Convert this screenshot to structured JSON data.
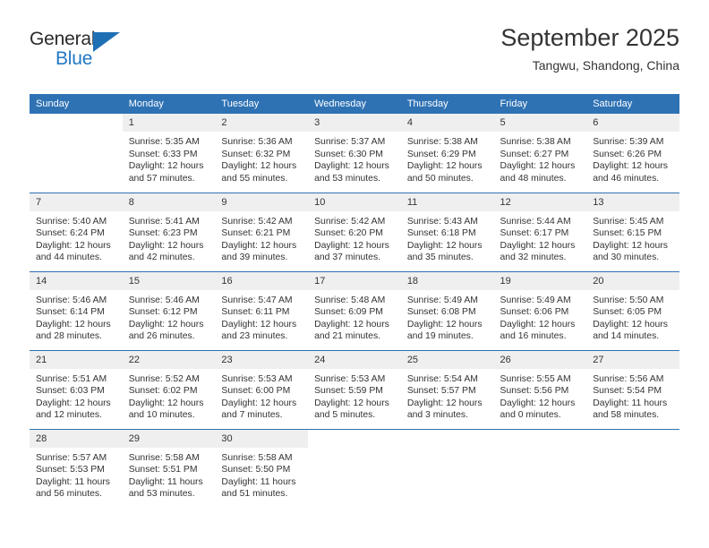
{
  "brand": {
    "name_part1": "General",
    "name_part2": "Blue",
    "triangle_icon": "triangle-icon"
  },
  "header": {
    "title": "September 2025",
    "subtitle": "Tangwu, Shandong, China"
  },
  "colors": {
    "header_blue": "#2e72b4",
    "daynum_band": "#efefef",
    "text": "#333333",
    "brand_blue": "#2278c4"
  },
  "calendar": {
    "weekday_headers": [
      "Sunday",
      "Monday",
      "Tuesday",
      "Wednesday",
      "Thursday",
      "Friday",
      "Saturday"
    ],
    "weeks": [
      [
        {
          "day": "",
          "sunrise": "",
          "sunset": "",
          "daylight_line1": "",
          "daylight_line2": ""
        },
        {
          "day": "1",
          "sunrise": "Sunrise: 5:35 AM",
          "sunset": "Sunset: 6:33 PM",
          "daylight_line1": "Daylight: 12 hours",
          "daylight_line2": "and 57 minutes."
        },
        {
          "day": "2",
          "sunrise": "Sunrise: 5:36 AM",
          "sunset": "Sunset: 6:32 PM",
          "daylight_line1": "Daylight: 12 hours",
          "daylight_line2": "and 55 minutes."
        },
        {
          "day": "3",
          "sunrise": "Sunrise: 5:37 AM",
          "sunset": "Sunset: 6:30 PM",
          "daylight_line1": "Daylight: 12 hours",
          "daylight_line2": "and 53 minutes."
        },
        {
          "day": "4",
          "sunrise": "Sunrise: 5:38 AM",
          "sunset": "Sunset: 6:29 PM",
          "daylight_line1": "Daylight: 12 hours",
          "daylight_line2": "and 50 minutes."
        },
        {
          "day": "5",
          "sunrise": "Sunrise: 5:38 AM",
          "sunset": "Sunset: 6:27 PM",
          "daylight_line1": "Daylight: 12 hours",
          "daylight_line2": "and 48 minutes."
        },
        {
          "day": "6",
          "sunrise": "Sunrise: 5:39 AM",
          "sunset": "Sunset: 6:26 PM",
          "daylight_line1": "Daylight: 12 hours",
          "daylight_line2": "and 46 minutes."
        }
      ],
      [
        {
          "day": "7",
          "sunrise": "Sunrise: 5:40 AM",
          "sunset": "Sunset: 6:24 PM",
          "daylight_line1": "Daylight: 12 hours",
          "daylight_line2": "and 44 minutes."
        },
        {
          "day": "8",
          "sunrise": "Sunrise: 5:41 AM",
          "sunset": "Sunset: 6:23 PM",
          "daylight_line1": "Daylight: 12 hours",
          "daylight_line2": "and 42 minutes."
        },
        {
          "day": "9",
          "sunrise": "Sunrise: 5:42 AM",
          "sunset": "Sunset: 6:21 PM",
          "daylight_line1": "Daylight: 12 hours",
          "daylight_line2": "and 39 minutes."
        },
        {
          "day": "10",
          "sunrise": "Sunrise: 5:42 AM",
          "sunset": "Sunset: 6:20 PM",
          "daylight_line1": "Daylight: 12 hours",
          "daylight_line2": "and 37 minutes."
        },
        {
          "day": "11",
          "sunrise": "Sunrise: 5:43 AM",
          "sunset": "Sunset: 6:18 PM",
          "daylight_line1": "Daylight: 12 hours",
          "daylight_line2": "and 35 minutes."
        },
        {
          "day": "12",
          "sunrise": "Sunrise: 5:44 AM",
          "sunset": "Sunset: 6:17 PM",
          "daylight_line1": "Daylight: 12 hours",
          "daylight_line2": "and 32 minutes."
        },
        {
          "day": "13",
          "sunrise": "Sunrise: 5:45 AM",
          "sunset": "Sunset: 6:15 PM",
          "daylight_line1": "Daylight: 12 hours",
          "daylight_line2": "and 30 minutes."
        }
      ],
      [
        {
          "day": "14",
          "sunrise": "Sunrise: 5:46 AM",
          "sunset": "Sunset: 6:14 PM",
          "daylight_line1": "Daylight: 12 hours",
          "daylight_line2": "and 28 minutes."
        },
        {
          "day": "15",
          "sunrise": "Sunrise: 5:46 AM",
          "sunset": "Sunset: 6:12 PM",
          "daylight_line1": "Daylight: 12 hours",
          "daylight_line2": "and 26 minutes."
        },
        {
          "day": "16",
          "sunrise": "Sunrise: 5:47 AM",
          "sunset": "Sunset: 6:11 PM",
          "daylight_line1": "Daylight: 12 hours",
          "daylight_line2": "and 23 minutes."
        },
        {
          "day": "17",
          "sunrise": "Sunrise: 5:48 AM",
          "sunset": "Sunset: 6:09 PM",
          "daylight_line1": "Daylight: 12 hours",
          "daylight_line2": "and 21 minutes."
        },
        {
          "day": "18",
          "sunrise": "Sunrise: 5:49 AM",
          "sunset": "Sunset: 6:08 PM",
          "daylight_line1": "Daylight: 12 hours",
          "daylight_line2": "and 19 minutes."
        },
        {
          "day": "19",
          "sunrise": "Sunrise: 5:49 AM",
          "sunset": "Sunset: 6:06 PM",
          "daylight_line1": "Daylight: 12 hours",
          "daylight_line2": "and 16 minutes."
        },
        {
          "day": "20",
          "sunrise": "Sunrise: 5:50 AM",
          "sunset": "Sunset: 6:05 PM",
          "daylight_line1": "Daylight: 12 hours",
          "daylight_line2": "and 14 minutes."
        }
      ],
      [
        {
          "day": "21",
          "sunrise": "Sunrise: 5:51 AM",
          "sunset": "Sunset: 6:03 PM",
          "daylight_line1": "Daylight: 12 hours",
          "daylight_line2": "and 12 minutes."
        },
        {
          "day": "22",
          "sunrise": "Sunrise: 5:52 AM",
          "sunset": "Sunset: 6:02 PM",
          "daylight_line1": "Daylight: 12 hours",
          "daylight_line2": "and 10 minutes."
        },
        {
          "day": "23",
          "sunrise": "Sunrise: 5:53 AM",
          "sunset": "Sunset: 6:00 PM",
          "daylight_line1": "Daylight: 12 hours",
          "daylight_line2": "and 7 minutes."
        },
        {
          "day": "24",
          "sunrise": "Sunrise: 5:53 AM",
          "sunset": "Sunset: 5:59 PM",
          "daylight_line1": "Daylight: 12 hours",
          "daylight_line2": "and 5 minutes."
        },
        {
          "day": "25",
          "sunrise": "Sunrise: 5:54 AM",
          "sunset": "Sunset: 5:57 PM",
          "daylight_line1": "Daylight: 12 hours",
          "daylight_line2": "and 3 minutes."
        },
        {
          "day": "26",
          "sunrise": "Sunrise: 5:55 AM",
          "sunset": "Sunset: 5:56 PM",
          "daylight_line1": "Daylight: 12 hours",
          "daylight_line2": "and 0 minutes."
        },
        {
          "day": "27",
          "sunrise": "Sunrise: 5:56 AM",
          "sunset": "Sunset: 5:54 PM",
          "daylight_line1": "Daylight: 11 hours",
          "daylight_line2": "and 58 minutes."
        }
      ],
      [
        {
          "day": "28",
          "sunrise": "Sunrise: 5:57 AM",
          "sunset": "Sunset: 5:53 PM",
          "daylight_line1": "Daylight: 11 hours",
          "daylight_line2": "and 56 minutes."
        },
        {
          "day": "29",
          "sunrise": "Sunrise: 5:58 AM",
          "sunset": "Sunset: 5:51 PM",
          "daylight_line1": "Daylight: 11 hours",
          "daylight_line2": "and 53 minutes."
        },
        {
          "day": "30",
          "sunrise": "Sunrise: 5:58 AM",
          "sunset": "Sunset: 5:50 PM",
          "daylight_line1": "Daylight: 11 hours",
          "daylight_line2": "and 51 minutes."
        },
        {
          "day": "",
          "sunrise": "",
          "sunset": "",
          "daylight_line1": "",
          "daylight_line2": ""
        },
        {
          "day": "",
          "sunrise": "",
          "sunset": "",
          "daylight_line1": "",
          "daylight_line2": ""
        },
        {
          "day": "",
          "sunrise": "",
          "sunset": "",
          "daylight_line1": "",
          "daylight_line2": ""
        },
        {
          "day": "",
          "sunrise": "",
          "sunset": "",
          "daylight_line1": "",
          "daylight_line2": ""
        }
      ]
    ]
  }
}
